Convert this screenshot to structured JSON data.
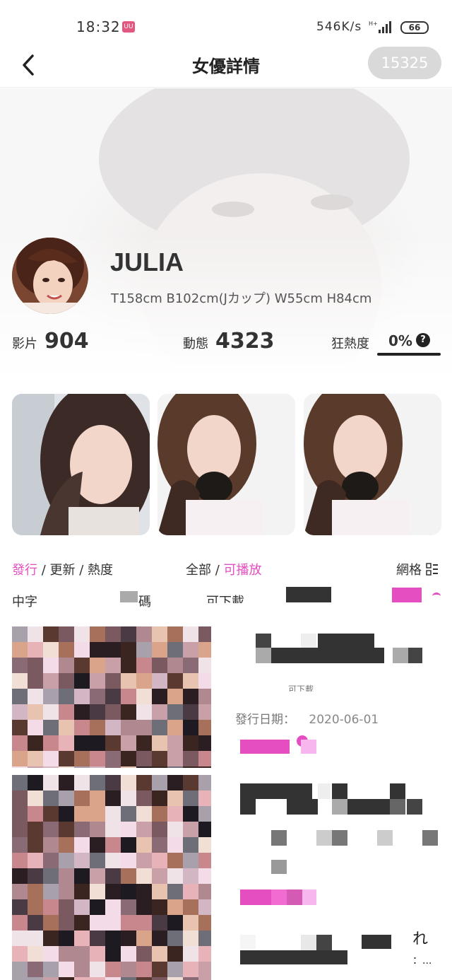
{
  "status": {
    "time": "18:32",
    "app_icon": "UU",
    "speed": "546K/s",
    "network": "H+",
    "battery": "66"
  },
  "nav": {
    "title": "女優詳情",
    "count": "15325"
  },
  "actress": {
    "name": "JULIA",
    "measurements": "T158cm B102cm(Jカップ) W55cm H84cm"
  },
  "stats": [
    {
      "label": "影片",
      "value": "904"
    },
    {
      "label": "動態",
      "value": "4323"
    }
  ],
  "heat": {
    "label": "狂熱度",
    "value": "0%",
    "help": "?"
  },
  "filters": {
    "sort": {
      "active": "發行",
      "sep1": " / ",
      "opt2": "更新",
      "sep2": " / ",
      "opt3": "熱度"
    },
    "scope": {
      "opt1": "全部",
      "sep": " / ",
      "active": "可播放"
    },
    "view_label": "網格"
  },
  "tags": {
    "tag1": "中字",
    "tag2_partial": "碼",
    "tag3_partial": "可下載"
  },
  "videos": [
    {
      "date_label": "發行日期：",
      "date": "2020-06-01"
    }
  ],
  "misc": {
    "partial_text_1": "れ",
    "partial_text_2": "：..."
  },
  "colors": {
    "accent": "#e44ec0",
    "pill": "#d9d9d9"
  }
}
